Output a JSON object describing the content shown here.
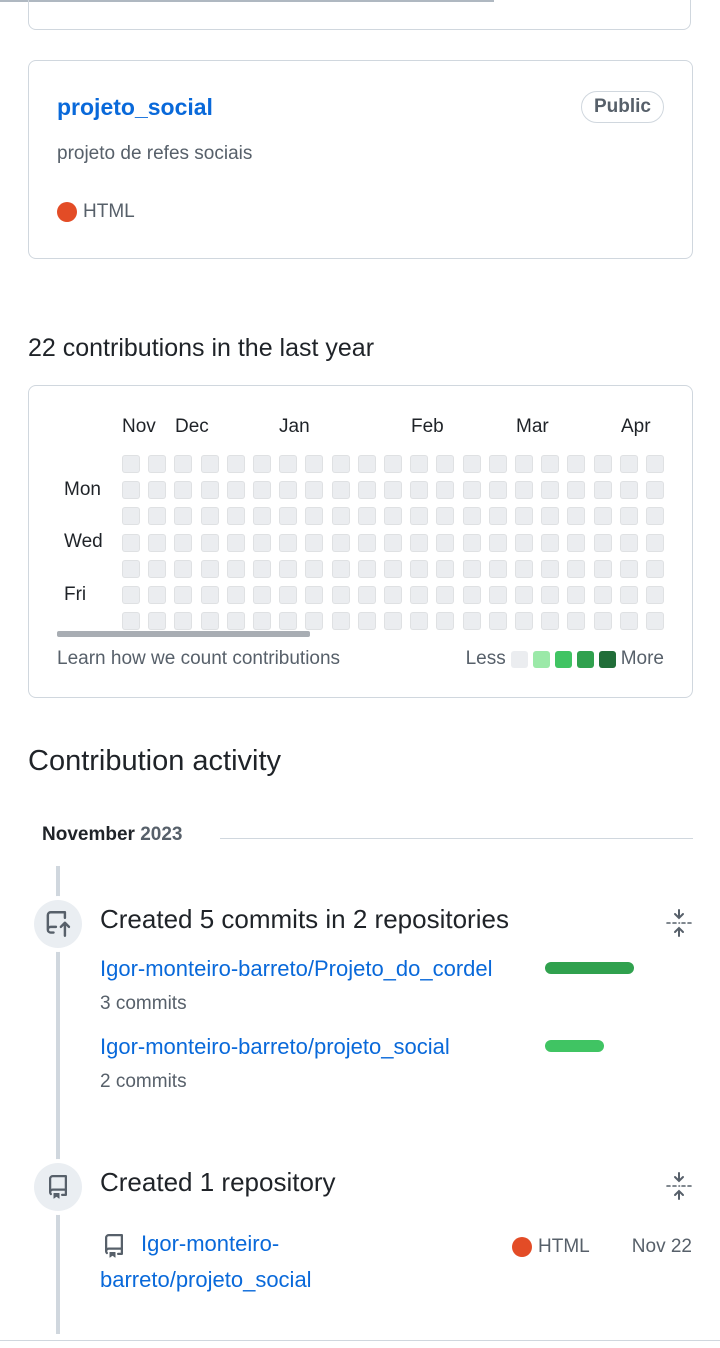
{
  "top_card": {},
  "repo_card": {
    "name": "projeto_social",
    "visibility": "Public",
    "description": "projeto de refes sociais",
    "language": "HTML",
    "language_color": "#e34c26"
  },
  "contributions": {
    "heading": "22 contributions in the last year",
    "months": [
      "Nov",
      "Dec",
      "Jan",
      "Feb",
      "Mar",
      "Apr"
    ],
    "days": [
      "Mon",
      "Wed",
      "Fri"
    ],
    "learn_link": "Learn how we count contributions",
    "legend_less": "Less",
    "legend_more": "More",
    "legend_colors": [
      "#ebedf0",
      "#9be9a8",
      "#40c463",
      "#30a14e",
      "#216e39"
    ]
  },
  "activity": {
    "heading": "Contribution activity",
    "month": "November",
    "year": "2023",
    "commits_event": {
      "title": "Created 5 commits in 2 repositories",
      "repos": [
        {
          "name": "Igor-monteiro-barreto/Projeto_do_cordel",
          "count": "3 commits",
          "bar_color": "#30a14e",
          "share": 0.6
        },
        {
          "name": "Igor-monteiro-barreto/projeto_social",
          "count": "2 commits",
          "bar_color": "#40c463",
          "share": 0.4
        }
      ]
    },
    "repo_event": {
      "title": "Created 1 repository",
      "repo_name_line1": "Igor-monteiro-",
      "repo_name_line2": "barreto/projeto_social",
      "language": "HTML",
      "language_color": "#e34c26",
      "date": "Nov 22"
    }
  }
}
